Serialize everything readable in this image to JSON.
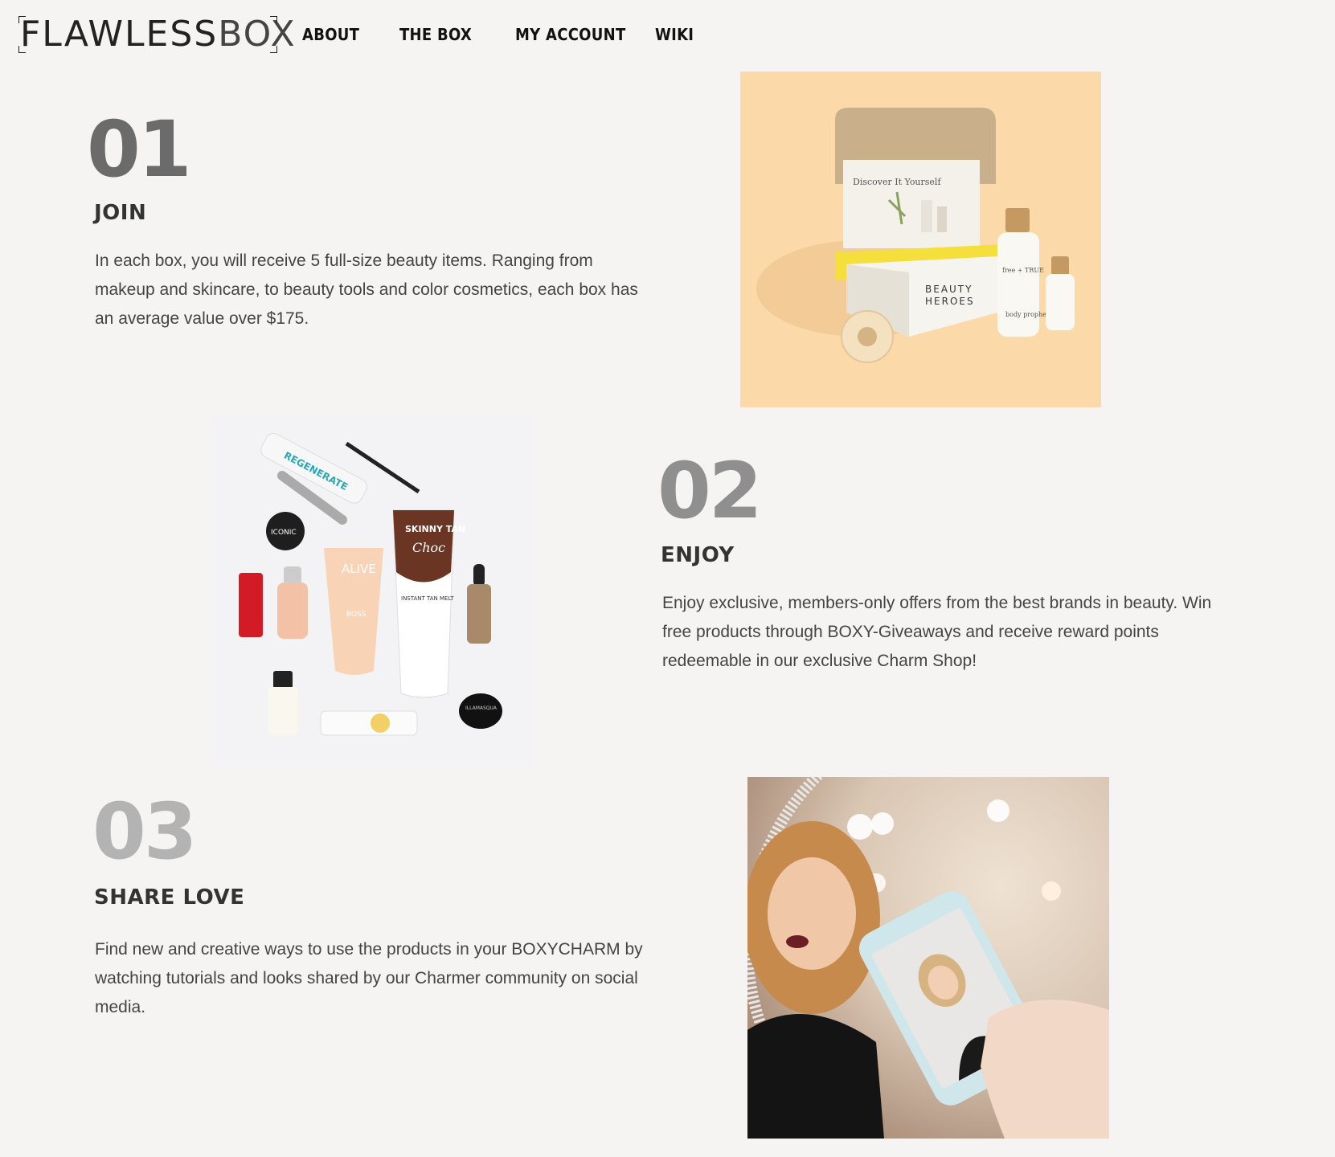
{
  "header": {
    "logo_bold": "FLAWLESS",
    "logo_light": "BOX",
    "nav": [
      "ABOUT",
      "THE BOX",
      "MY ACCOUNT",
      "WIKI"
    ]
  },
  "steps": [
    {
      "number": "01",
      "title": "JOIN",
      "text": "In each box, you will receive 5 full-size beauty items. Ranging from makeup and skincare, to beauty tools and color cosmetics, each box has an average value over $175.",
      "color": "#6b6b6b"
    },
    {
      "number": "02",
      "title": "ENJOY",
      "text": "Enjoy exclusive, members-only offers from the best brands in beauty. Win free products through BOXY-Giveaways and receive reward points redeemable in our exclusive Charm Shop!",
      "color": "#8f8f8f"
    },
    {
      "number": "03",
      "title": "SHARE LOVE",
      "text": "Find new and creative ways to use the products in your BOXYCHARM by watching tutorials and looks shared by our Charmer community on social media.",
      "color": "#b3b3b3"
    }
  ],
  "images": {
    "box": {
      "card_title": "Discover It Yourself",
      "box_label_1": "BEAUTY",
      "box_label_2": "HEROES",
      "bottle_brand": "free + TRUE",
      "bottle_text": "body prophet"
    },
    "products": {
      "tube_label": "REGENERATE",
      "jar_label": "ICONIC",
      "cream_label": "ALIVE",
      "cream_sub": "BOSS",
      "tan_brand": "SKINNY TAN",
      "tan_sub": "Choc",
      "tan_desc": "INSTANT TAN MELT",
      "black_jar_label": "ILLAMASQUA"
    }
  }
}
